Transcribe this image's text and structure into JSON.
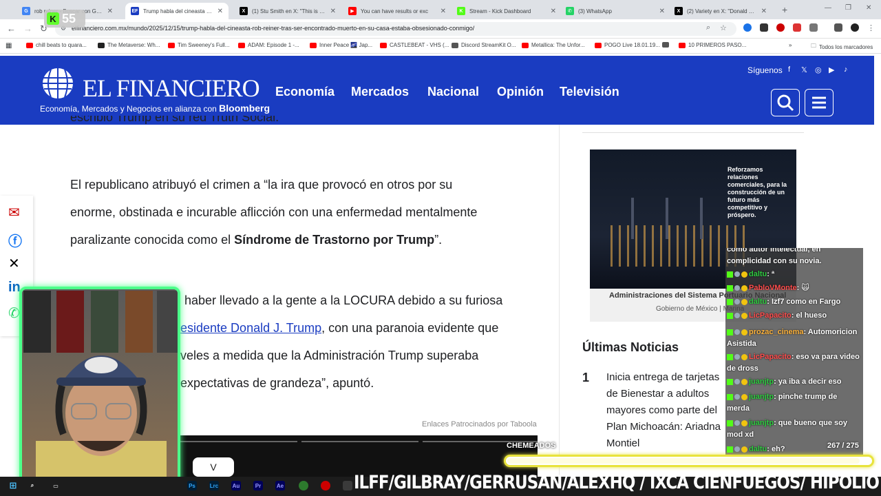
{
  "browser": {
    "tabs": [
      {
        "title": "rob reiner - Buscar con Google",
        "fav_color": "#4285f4",
        "fav_glyph": "G"
      },
      {
        "title": "Trump habla del cineasta Rob R",
        "fav_color": "#1a3cc1",
        "fav_glyph": "EF"
      },
      {
        "title": "(1) Stu Smith en X: \"This is a rea",
        "fav_color": "#000000",
        "fav_glyph": "X"
      },
      {
        "title": "You can have results or exc",
        "fav_color": "#ff0000",
        "fav_glyph": "▶"
      },
      {
        "title": "Stream - Kick Dashboard",
        "fav_color": "#53fc18",
        "fav_glyph": "K"
      },
      {
        "title": "(3) WhatsApp",
        "fav_color": "#25d366",
        "fav_glyph": "✆"
      },
      {
        "title": "(2) Variety en X: \"Donald Trump",
        "fav_color": "#000000",
        "fav_glyph": "X"
      }
    ],
    "url": "elfinanciero.com.mx/mundo/2025/12/15/trump-habla-del-cineasta-rob-reiner-tras-ser-encontrado-muerto-en-su-casa-estaba-obsesionado-conmigo/",
    "bookmarks": [
      {
        "label": "chill beats to quara...",
        "color": "#ff0000"
      },
      {
        "label": "The Metaverse: Wh...",
        "color": "#222222"
      },
      {
        "label": "Tim Sweeney's Full...",
        "color": "#ff0000"
      },
      {
        "label": "ADAM: Episode 1 -...",
        "color": "#ff0000"
      },
      {
        "label": "Inner Peace 🌌 Jap...",
        "color": "#ff0000"
      },
      {
        "label": "CASTLEBEAT - VHS (...",
        "color": "#ff0000"
      },
      {
        "label": "Discord StreamKit O...",
        "color": "#555555"
      },
      {
        "label": "Metallica: The Unfor...",
        "color": "#ff0000"
      },
      {
        "label": "POGO Live 18.01.19...",
        "color": "#ff0000"
      },
      {
        "label": "",
        "color": "#555555"
      },
      {
        "label": "10 PRIMEROS PASO...",
        "color": "#ff0000"
      }
    ],
    "all_bookmarks": "Todos los marcadores"
  },
  "site": {
    "logo": "EL FINANCIERO",
    "tagline": "Economía, Mercados y Negocios en alianza con",
    "tagline_brand": "Bloomberg",
    "nav": [
      "Economía",
      "Mercados",
      "Nacional",
      "Opinión",
      "Televisión"
    ],
    "siguenos": "Síguenos",
    "header_color": "#1a3cc1"
  },
  "article": {
    "top_line": "escribió Trump en su red Truth Social.",
    "p1_line1": "El republicano atribuyó el crimen a “la ira que provocó en otros por su",
    "p1_line2": "enorme, obstinada e incurable aflicción con una enfermedad mentalmente",
    "p1_line3_pre": "paralizante conocida como el ",
    "p1_line3_bold": "Síndrome de Trastorno por Trump",
    "p1_line3_post": "”.",
    "p2_line1": "haber llevado a la gente a la LOCURA debido a su furiosa",
    "p2_line2_link": "esidente Donald J. Trump",
    "p2_line2_post": ", con una paranoia evidente que",
    "p2_line3": "veles a medida que la Administración Trump superaba",
    "p2_line4": "expectativas de grandeza”, apuntó.",
    "taboola": "Enlaces Patrocinados por Taboola",
    "video_button": "V"
  },
  "sidebar": {
    "ad_text": "Reforzamos relaciones comerciales, para la construcción de un futuro más competitivo y próspero.",
    "ad_banner": "Administraciones del Sistema Portuario Nacional",
    "ad_gov": "Gobierno de México | Marina",
    "ultimas_title": "Últimas Noticias",
    "news_number": "1",
    "news_lines": [
      "Inicia entrega de tarjetas",
      "de Bienestar a adultos",
      "mayores como parte del",
      "Plan Michoacán: Ariadna",
      "Montiel"
    ]
  },
  "chat": {
    "messages": [
      {
        "user": "",
        "text": "como autor intelectual, en complicidad con su novia.",
        "ucolor": "u"
      },
      {
        "user": "daltu",
        "text": ": ª",
        "ucolor": "u"
      },
      {
        "user": "PabloVMonte",
        "text": ": 🙀",
        "ucolor": "u2"
      },
      {
        "user": "daltu",
        "text": ": Izf7 como en Fargo",
        "ucolor": "u"
      },
      {
        "user": "LicPapacito",
        "text": ": el hueso",
        "ucolor": "u2"
      },
      {
        "user": "prozac_cinema",
        "text": ": Automoricion Asistida",
        "ucolor": "u3"
      },
      {
        "user": "LicPapacito",
        "text": ": eso va para video de dross",
        "ucolor": "u2"
      },
      {
        "user": "juanjtp",
        "text": ": ya iba a decir eso",
        "ucolor": "u"
      },
      {
        "user": "juanjtp",
        "text": ": pinche trump de merda",
        "ucolor": "u"
      },
      {
        "user": "juanjtp",
        "text": ": que bueno que soy mod xd",
        "ucolor": "u"
      },
      {
        "user": "daltu",
        "text": ": eh?",
        "ucolor": "u"
      }
    ],
    "goal_label": "CHEMEADOS",
    "goal_count": "267 / 275",
    "goal_progress": 0.97
  },
  "ticker": "ILFF/GILBRAY/GERRUSAN/ALEXHQ / IXCA CIENFUEGOS/ HIPOLIO / EL_EMURI / LUISSPV/YEYO127",
  "kick_badge": "55"
}
